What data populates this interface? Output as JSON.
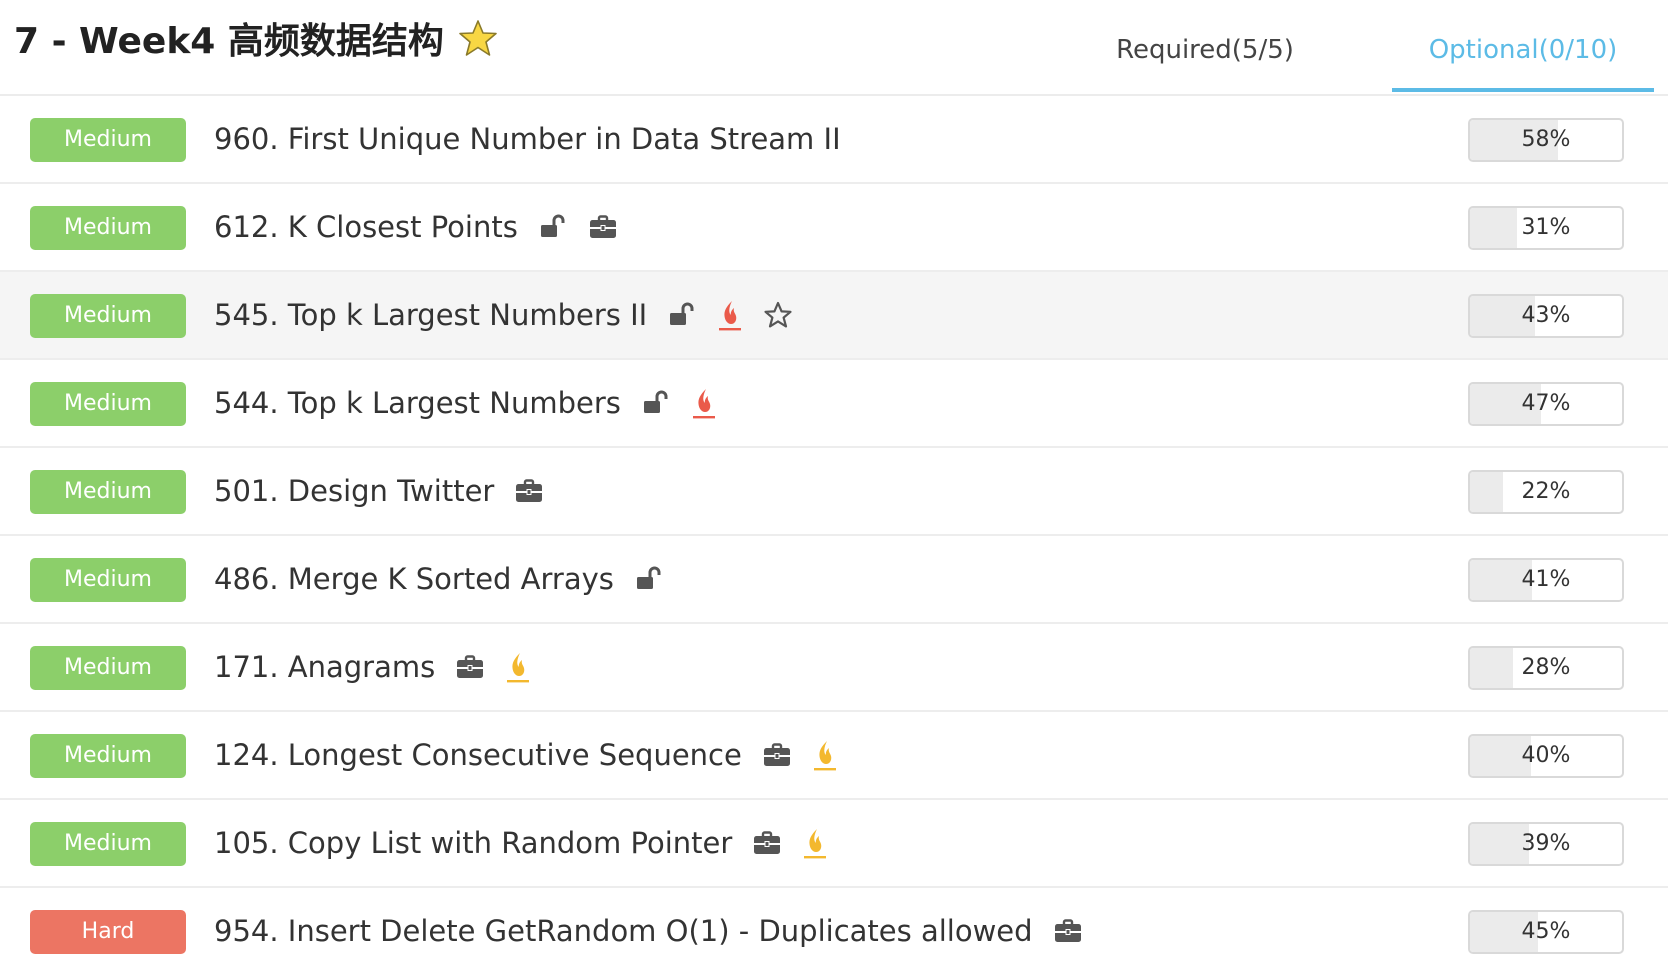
{
  "header": {
    "title": "7 - Week4 高频数据结构",
    "tabs": [
      {
        "label": "Required(5/5)",
        "active": false
      },
      {
        "label": "Optional(0/10)",
        "active": true
      }
    ]
  },
  "colors": {
    "accent": "#5cbbe6",
    "medium": "#8ccf6a",
    "hard": "#ec7563",
    "fire_hot": "#ea5a4a",
    "fire_warm": "#f3b82e",
    "star_fill": "#f8d743"
  },
  "problems": [
    {
      "difficulty": "Medium",
      "name": "960. First Unique Number in Data Stream II",
      "icons": [],
      "acceptance": "58%",
      "rate": 0.58
    },
    {
      "difficulty": "Medium",
      "name": "612. K Closest Points",
      "icons": [
        "unlock-icon",
        "briefcase-icon"
      ],
      "acceptance": "31%",
      "rate": 0.31
    },
    {
      "difficulty": "Medium",
      "name": "545. Top k Largest Numbers II",
      "icons": [
        "unlock-icon",
        "fire-hot-icon",
        "star-outline-icon"
      ],
      "acceptance": "43%",
      "rate": 0.43
    },
    {
      "difficulty": "Medium",
      "name": "544. Top k Largest Numbers",
      "icons": [
        "unlock-icon",
        "fire-hot-icon"
      ],
      "acceptance": "47%",
      "rate": 0.47
    },
    {
      "difficulty": "Medium",
      "name": "501. Design Twitter",
      "icons": [
        "briefcase-icon"
      ],
      "acceptance": "22%",
      "rate": 0.22
    },
    {
      "difficulty": "Medium",
      "name": "486. Merge K Sorted Arrays",
      "icons": [
        "unlock-icon"
      ],
      "acceptance": "41%",
      "rate": 0.41
    },
    {
      "difficulty": "Medium",
      "name": "171. Anagrams",
      "icons": [
        "briefcase-icon",
        "fire-warm-icon"
      ],
      "acceptance": "28%",
      "rate": 0.28
    },
    {
      "difficulty": "Medium",
      "name": "124. Longest Consecutive Sequence",
      "icons": [
        "briefcase-icon",
        "fire-warm-icon"
      ],
      "acceptance": "40%",
      "rate": 0.4
    },
    {
      "difficulty": "Medium",
      "name": "105. Copy List with Random Pointer",
      "icons": [
        "briefcase-icon",
        "fire-warm-icon"
      ],
      "acceptance": "39%",
      "rate": 0.39
    },
    {
      "difficulty": "Hard",
      "name": "954. Insert Delete GetRandom O(1) - Duplicates allowed",
      "icons": [
        "briefcase-icon"
      ],
      "acceptance": "45%",
      "rate": 0.45
    }
  ]
}
